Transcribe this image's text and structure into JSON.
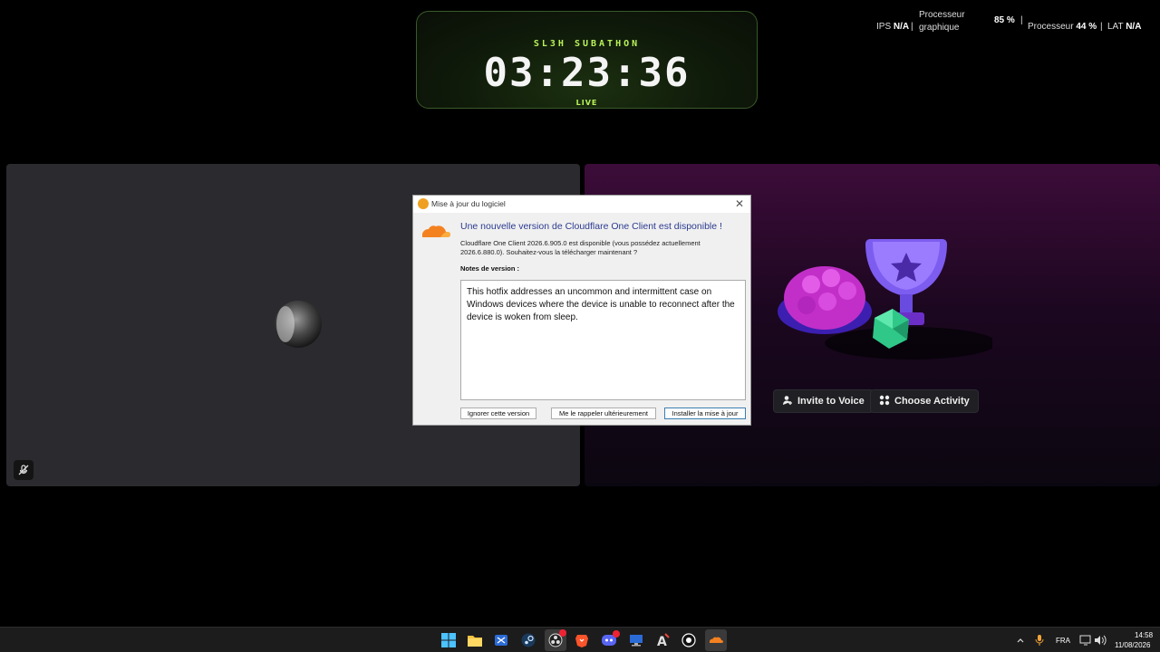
{
  "timer": {
    "label": "SL3H SUBATHON",
    "time": "03:23:36",
    "status": "LIVE",
    "accent": "#b9f35a"
  },
  "stats": {
    "ips_label": "IPS",
    "ips_value": "N/A",
    "gpu_label": "Processeur graphique",
    "gpu_value": "85 %",
    "cpu_label": "Processeur",
    "cpu_value": "44 %",
    "lat_label": "LAT",
    "lat_value": "N/A"
  },
  "tiles": {
    "left": {
      "mute_icon": "mic-muted-icon"
    },
    "right": {
      "invite_label": "Invite to Voice",
      "activity_label": "Choose Activity"
    }
  },
  "dialog": {
    "title": "Mise à jour du logiciel",
    "heading": "Une nouvelle version de Cloudflare One Client est disponible !",
    "description": "Cloudflare One Client 2026.6.905.0 est disponible (vous possédez actuellement 2026.6.880.0). Souhaitez-vous la télécharger maintenant ?",
    "notes_label": "Notes de version :",
    "notes_text": "This hotfix addresses an uncommon and intermittent case on Windows devices where the device is unable to reconnect after the device is woken from sleep.",
    "buttons": {
      "skip": "Ignorer cette version",
      "remind": "Me le rappeler ultérieurement",
      "install": "Installer la mise à jour"
    }
  },
  "taskbar": {
    "apps": [
      "windows-start",
      "file-explorer",
      "snipping-tool",
      "steam",
      "obs",
      "brave",
      "discord",
      "remote-desktop",
      "anydesk",
      "obs-studio",
      "cloudflare"
    ],
    "discord_badge": "",
    "language": "FRA",
    "time": "14:58",
    "date": "11/08/2026"
  }
}
